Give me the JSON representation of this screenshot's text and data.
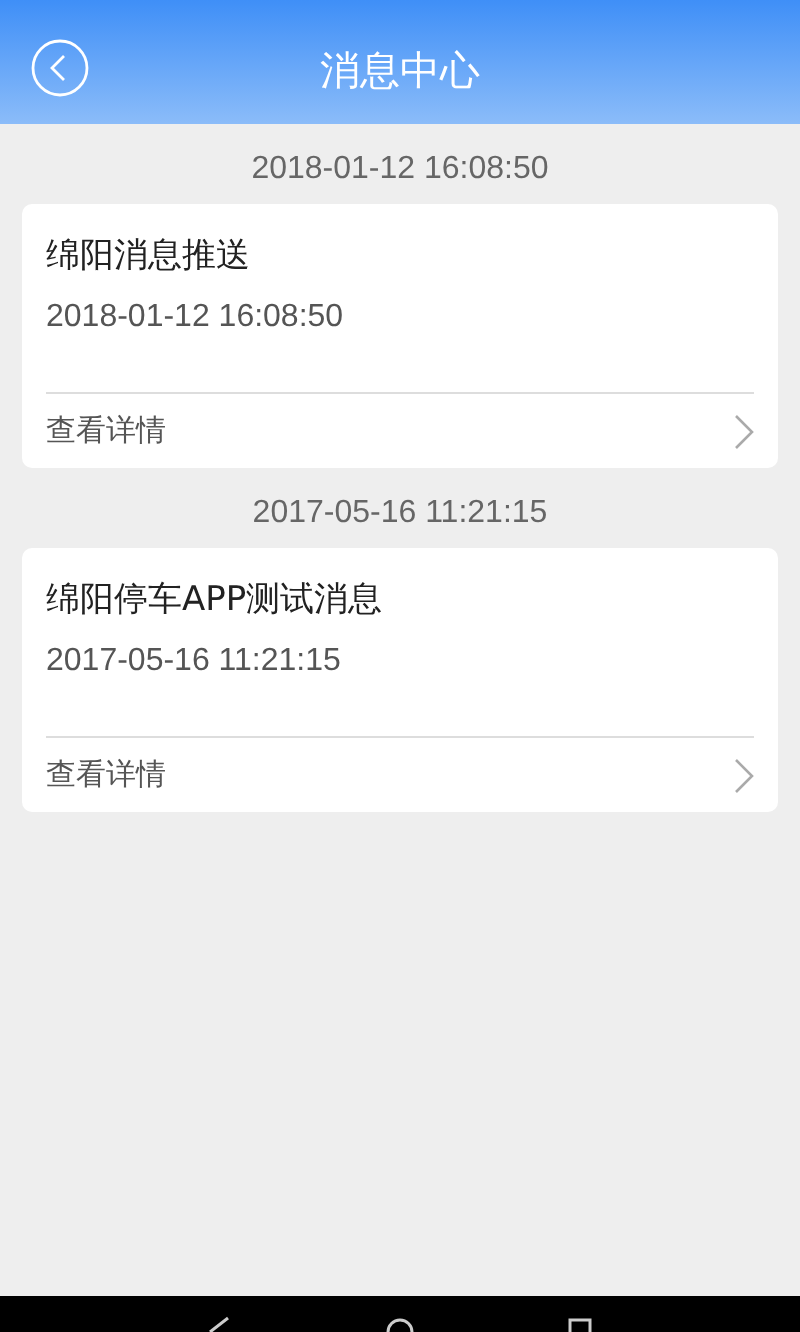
{
  "header": {
    "title": "消息中心"
  },
  "messages": [
    {
      "time": "2018-01-12 16:08:50",
      "title": "绵阳消息推送",
      "date": "2018-01-12 16:08:50",
      "link": "查看详情"
    },
    {
      "time": "2017-05-16 11:21:15",
      "title": "绵阳停车APP测试消息",
      "date": "2017-05-16 11:21:15",
      "link": "查看详情"
    }
  ]
}
